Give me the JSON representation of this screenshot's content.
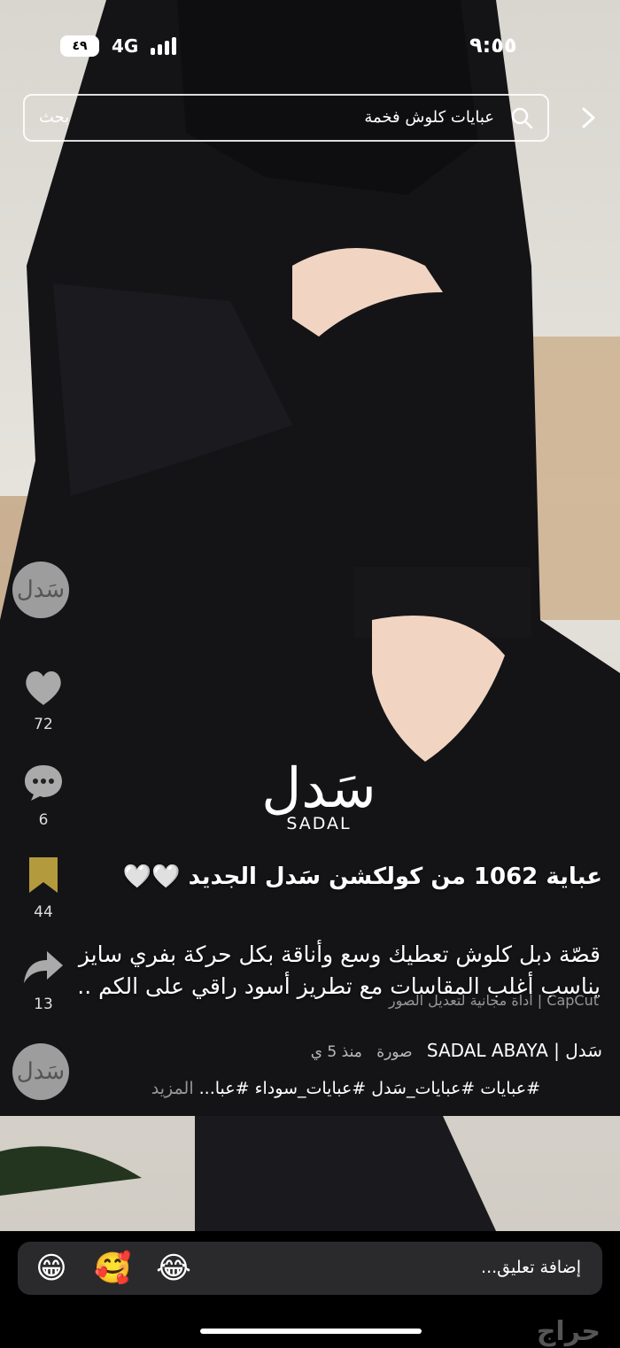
{
  "status_bar": {
    "battery": "٤٩",
    "network": "4G",
    "time": "٩:٥٥"
  },
  "search": {
    "value": "عبايات كلوش فخمة",
    "button_label": "بحث"
  },
  "side_actions": {
    "likes": "72",
    "comments": "6",
    "saves": "44",
    "shares": "13",
    "avatar_text": "سَدل"
  },
  "watermark": {
    "arabic": "سَدل",
    "latin": "SADAL"
  },
  "post": {
    "title": "عباية 1062 من كولكشن سَدل الجديد 🤍🤍",
    "description": "قصّة دبل كلوش تعطيك وسع وأناقة بكل حركة بفري سايز يناسب أغلب المقاسات مع تطريز أسود راقي على الكم ..",
    "capcut": "CapCut | أداة مجانية لتعديل الصور",
    "author": "سَدل | SADAL ABAYA",
    "post_type": "صورة",
    "post_age": "منذ 5 ي",
    "hashtags": "#عبايات #عبايات_سَدل #عبايات_سوداء #عبا...",
    "more_label": "المزيد"
  },
  "comment_bar": {
    "placeholder": "إضافة تعليق...",
    "emojis": [
      "😁",
      "🥰",
      "😂"
    ]
  },
  "brand": "حراج",
  "colors": {
    "background": "#000000",
    "comment_field": "#2a2a2c",
    "accent": "#ffffff"
  }
}
